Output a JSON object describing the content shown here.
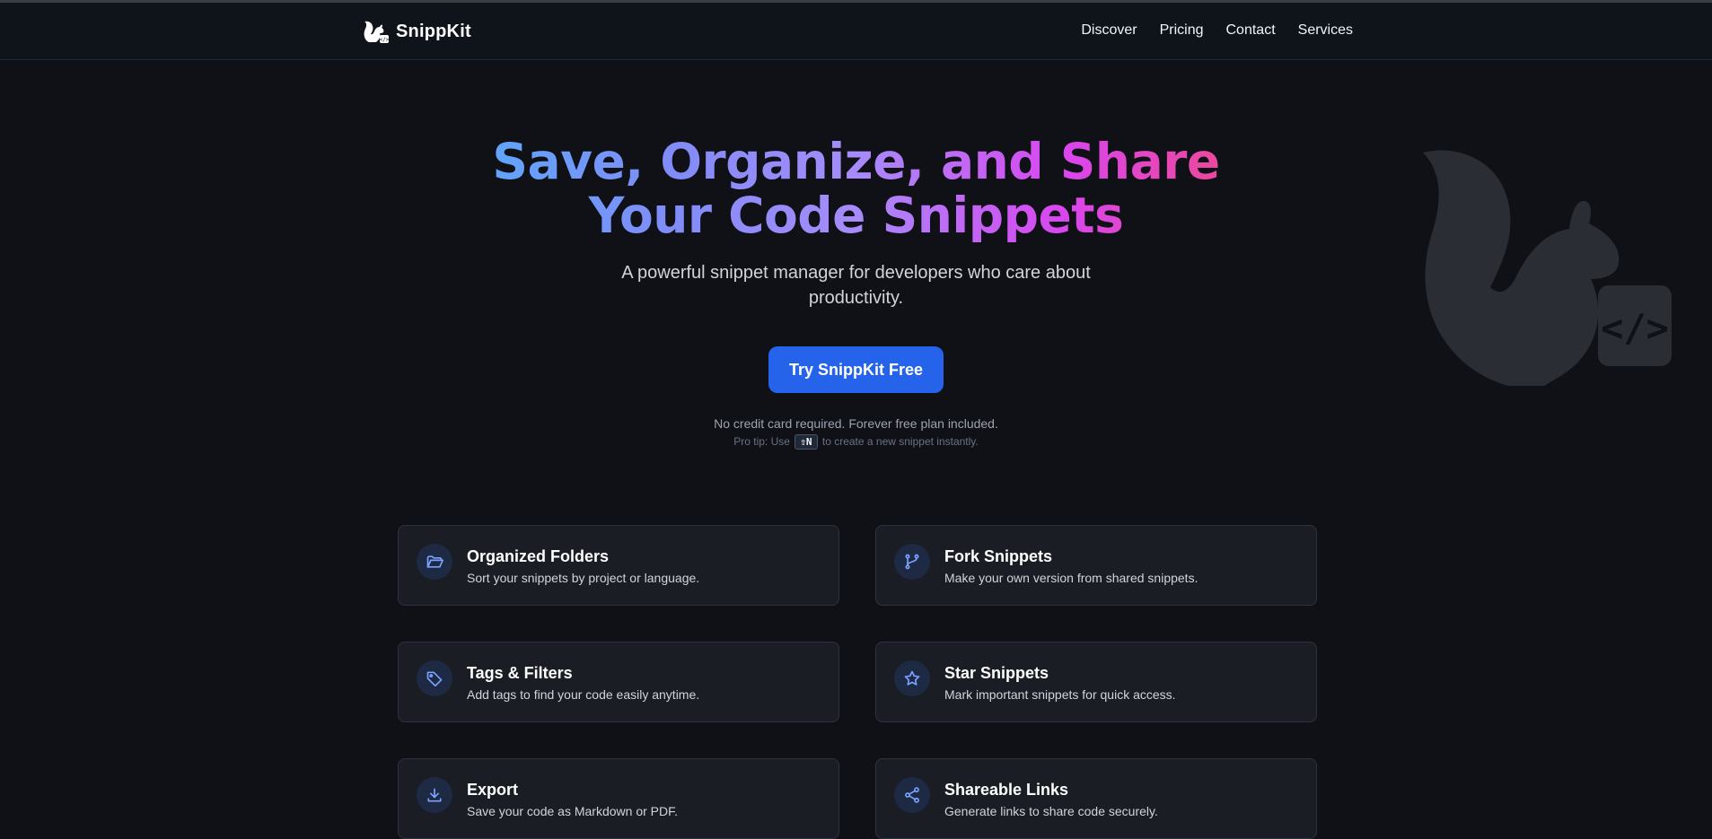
{
  "brand": {
    "name": "SnippKit",
    "logo_icon": "squirrel-logo-icon"
  },
  "nav": [
    "Discover",
    "Pricing",
    "Contact",
    "Services"
  ],
  "hero": {
    "title_line1": "Save, Organize, and Share",
    "title_line2": "Your Code Snippets",
    "subtitle": "A powerful snippet manager for developers who care about productivity.",
    "cta_label": "Try SnippKit Free",
    "note": "No credit card required. Forever free plan included.",
    "tip_prefix": "Pro tip: Use",
    "tip_key": "⇧N",
    "tip_suffix": "to create a new snippet instantly."
  },
  "features": [
    {
      "title": "Organized Folders",
      "desc": "Sort your snippets by project or language.",
      "icon": "folder-open-icon"
    },
    {
      "title": "Fork Snippets",
      "desc": "Make your own version from shared snippets.",
      "icon": "git-fork-icon"
    },
    {
      "title": "Tags & Filters",
      "desc": "Add tags to find your code easily anytime.",
      "icon": "tag-icon"
    },
    {
      "title": "Star Snippets",
      "desc": "Mark important snippets for quick access.",
      "icon": "star-icon"
    },
    {
      "title": "Export",
      "desc": "Save your code as Markdown or PDF.",
      "icon": "download-icon"
    },
    {
      "title": "Shareable Links",
      "desc": "Generate links to share code securely.",
      "icon": "share-icon"
    }
  ],
  "colors": {
    "background": "#0f1117",
    "accent": "#2563eb",
    "card": "#1a1d24",
    "icon": "#7aa2ff",
    "gradient": [
      "#60a5fa",
      "#818cf8",
      "#a78bfa",
      "#d946ef",
      "#ec4899"
    ]
  }
}
